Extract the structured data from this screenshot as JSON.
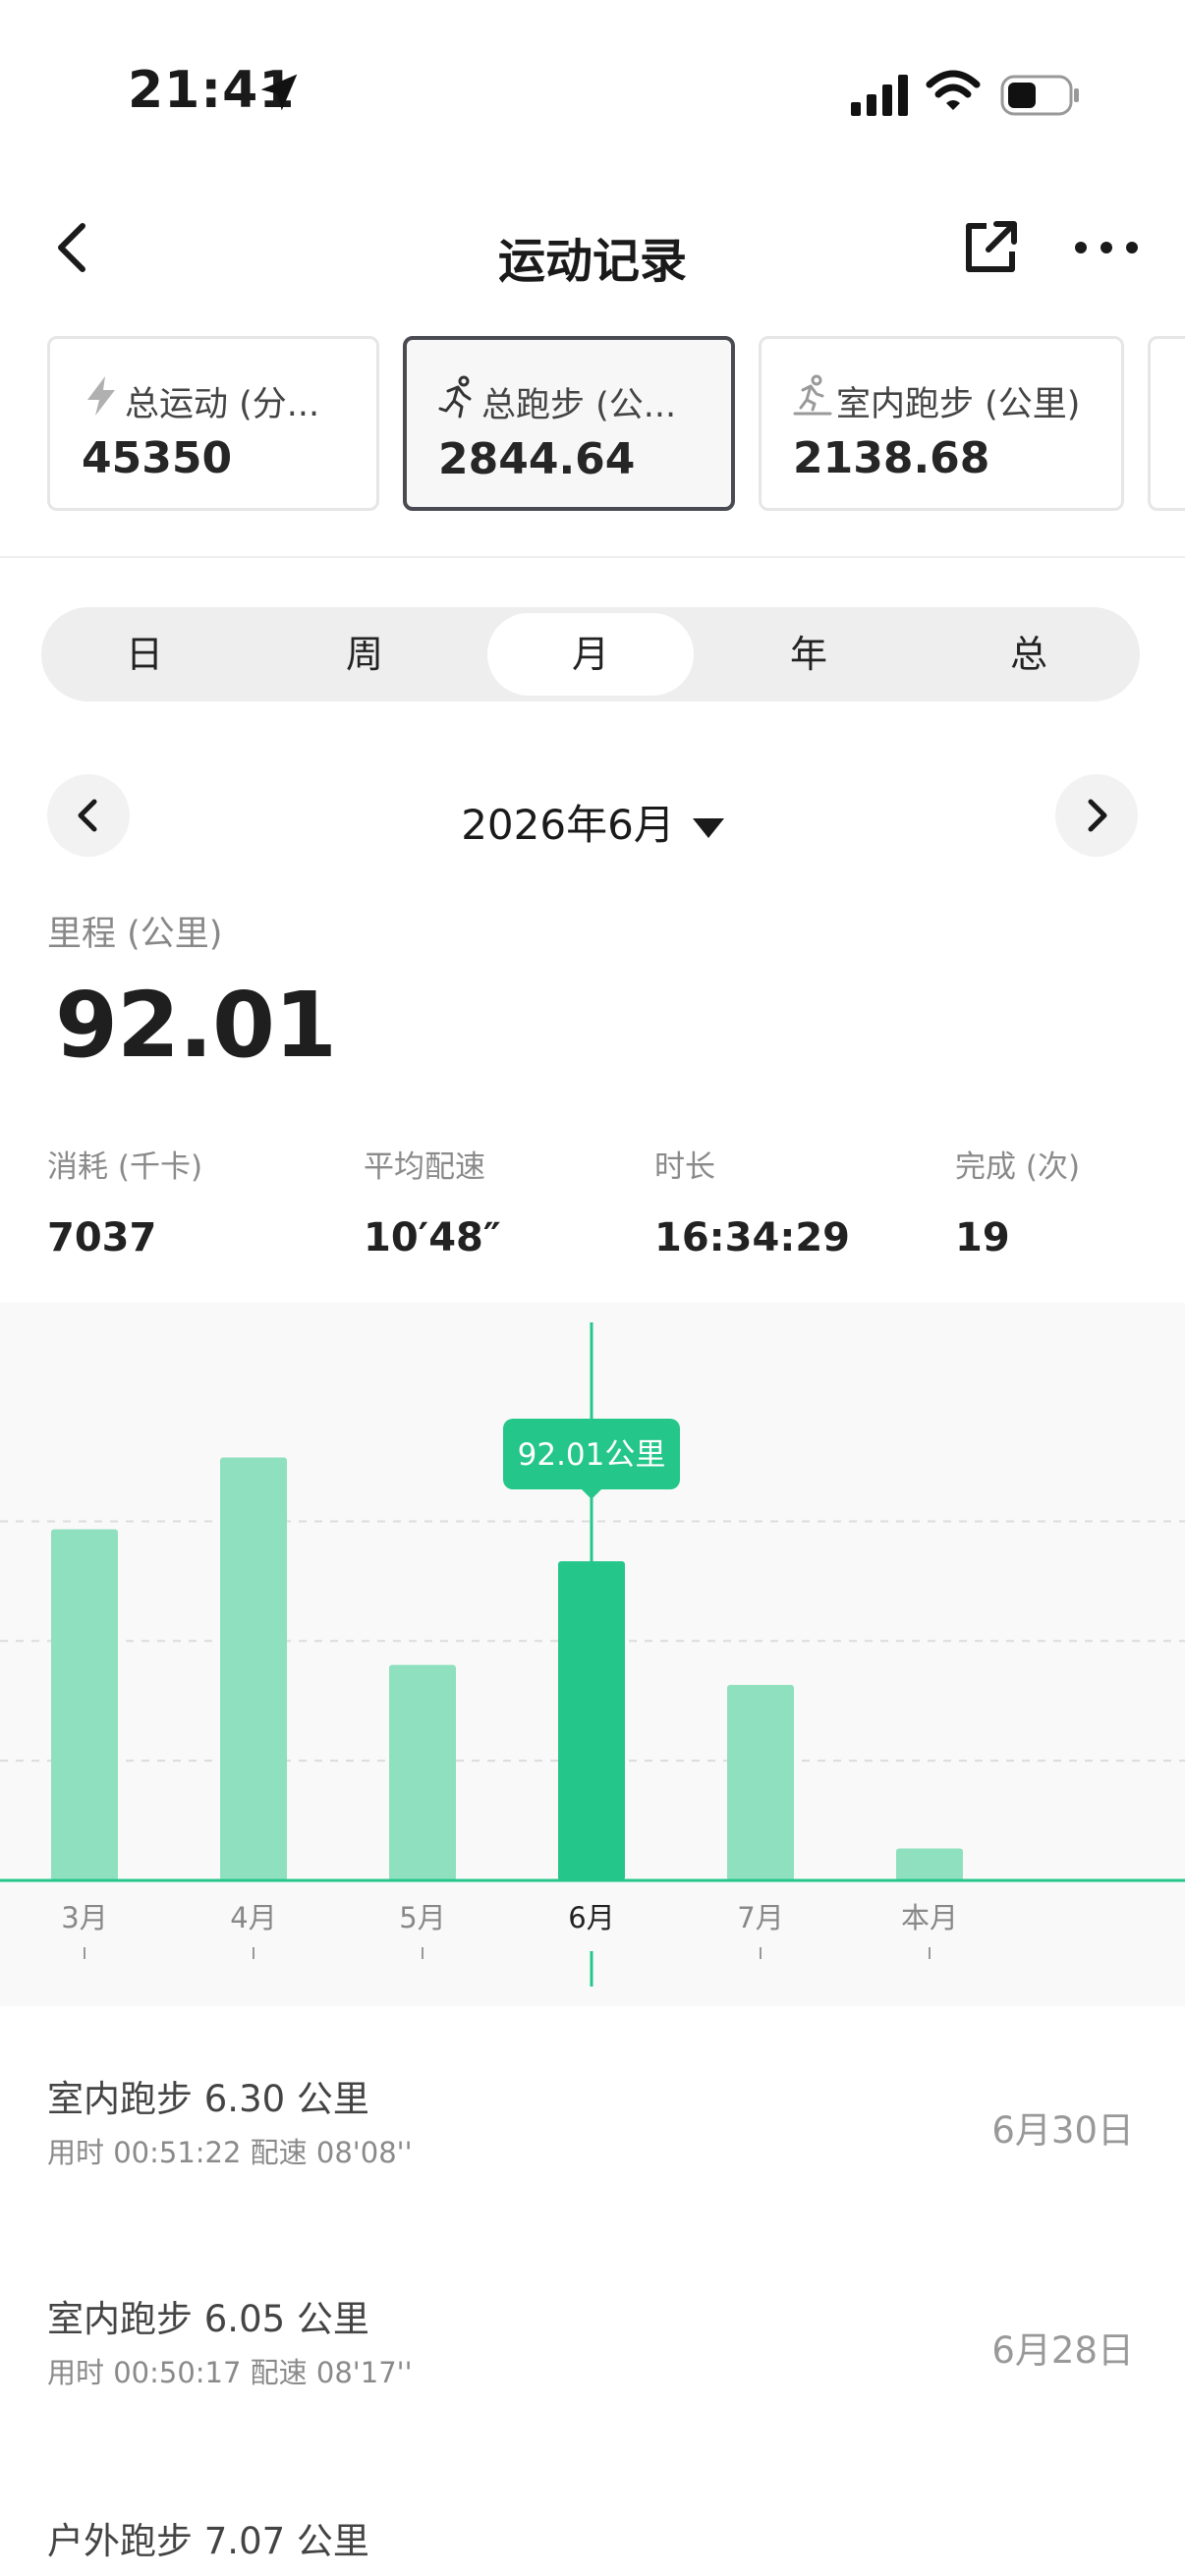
{
  "status_bar": {
    "time": "21:41"
  },
  "nav": {
    "title": "运动记录"
  },
  "cards": [
    {
      "icon": "lightning-icon",
      "label": "总运动 (分...",
      "value": "45350",
      "active": false
    },
    {
      "icon": "running-person-icon",
      "label": "总跑步 (公...",
      "value": "2844.64",
      "active": true
    },
    {
      "icon": "treadmill-run-icon",
      "label": "室内跑步 (公里)",
      "value": "2138.68",
      "active": false
    }
  ],
  "segment": {
    "items": [
      "日",
      "周",
      "月",
      "年",
      "总"
    ],
    "selected": "月"
  },
  "date_selector": {
    "label": "2026年6月"
  },
  "main_metric": {
    "label": "里程 (公里)",
    "value": "92.01"
  },
  "stats": [
    {
      "label": "消耗 (千卡)",
      "value": "7037"
    },
    {
      "label": "平均配速",
      "value": "10′48″"
    },
    {
      "label": "时长",
      "value": "16:34:29"
    },
    {
      "label": "完成 (次)",
      "value": "19"
    }
  ],
  "chart_data": {
    "type": "bar",
    "categories": [
      "3月",
      "4月",
      "5月",
      "6月",
      "7月",
      "本月"
    ],
    "values": [
      88,
      106,
      54,
      80,
      49,
      8
    ],
    "selected_index": 3,
    "tooltip": "92.01公里",
    "ylim": [
      0,
      130
    ],
    "grid": "dashed",
    "colors": {
      "bar": "#8ee0bf",
      "selected_bar": "#25c68a",
      "baseline": "#25c68a",
      "tooltip_bg": "#25c68a"
    }
  },
  "records": [
    {
      "title": "室内跑步  6.30 公里",
      "subtitle": "用时 00:51:22   配速 08'08''",
      "date": "6月30日"
    },
    {
      "title": "室内跑步  6.05 公里",
      "subtitle": "用时 00:50:17   配速 08'17''",
      "date": "6月28日"
    },
    {
      "title": "户外跑步  7.07 公里",
      "subtitle": "",
      "date": ""
    }
  ]
}
